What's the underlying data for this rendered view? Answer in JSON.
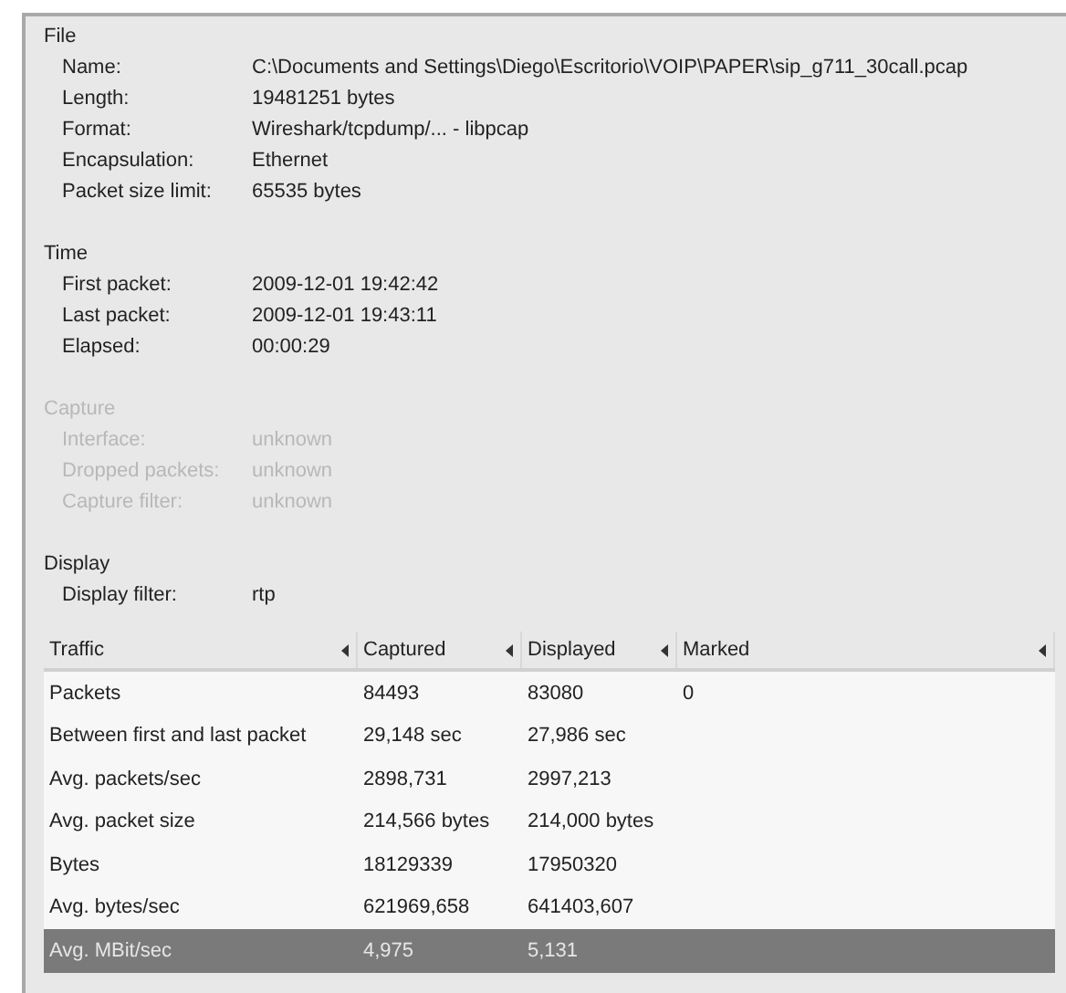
{
  "sections": [
    {
      "title": "File",
      "disabled": false,
      "fields": [
        {
          "label": "Name:",
          "value": "C:\\Documents and Settings\\Diego\\Escritorio\\VOIP\\PAPER\\sip_g711_30call.pcap"
        },
        {
          "label": "Length:",
          "value": "19481251 bytes"
        },
        {
          "label": "Format:",
          "value": "Wireshark/tcpdump/... - libpcap"
        },
        {
          "label": "Encapsulation:",
          "value": "Ethernet"
        },
        {
          "label": "Packet size limit:",
          "value": "65535 bytes"
        }
      ]
    },
    {
      "title": "Time",
      "disabled": false,
      "fields": [
        {
          "label": "First packet:",
          "value": "2009-12-01 19:42:42"
        },
        {
          "label": "Last packet:",
          "value": "2009-12-01 19:43:11"
        },
        {
          "label": "Elapsed:",
          "value": "00:00:29"
        }
      ]
    },
    {
      "title": "Capture",
      "disabled": true,
      "fields": [
        {
          "label": "Interface:",
          "value": "unknown"
        },
        {
          "label": "Dropped packets:",
          "value": "unknown"
        },
        {
          "label": "Capture filter:",
          "value": "unknown"
        }
      ]
    },
    {
      "title": "Display",
      "disabled": false,
      "fields": [
        {
          "label": "Display filter:",
          "value": "rtp"
        }
      ]
    }
  ],
  "table": {
    "columns": [
      "Traffic",
      "Captured",
      "Displayed",
      "Marked"
    ],
    "rows": [
      {
        "cells": [
          "Packets",
          "84493",
          "83080",
          "0"
        ],
        "selected": false
      },
      {
        "cells": [
          "Between first and last packet",
          "29,148 sec",
          "27,986 sec",
          ""
        ],
        "selected": false
      },
      {
        "cells": [
          "Avg. packets/sec",
          "2898,731",
          "2997,213",
          ""
        ],
        "selected": false
      },
      {
        "cells": [
          "Avg. packet size",
          "214,566 bytes",
          "214,000 bytes",
          ""
        ],
        "selected": false
      },
      {
        "cells": [
          "Bytes",
          "18129339",
          "17950320",
          ""
        ],
        "selected": false
      },
      {
        "cells": [
          "Avg. bytes/sec",
          "621969,658",
          "641403,607",
          ""
        ],
        "selected": false
      },
      {
        "cells": [
          "Avg. MBit/sec",
          "4,975",
          "5,131",
          ""
        ],
        "selected": true
      }
    ]
  }
}
